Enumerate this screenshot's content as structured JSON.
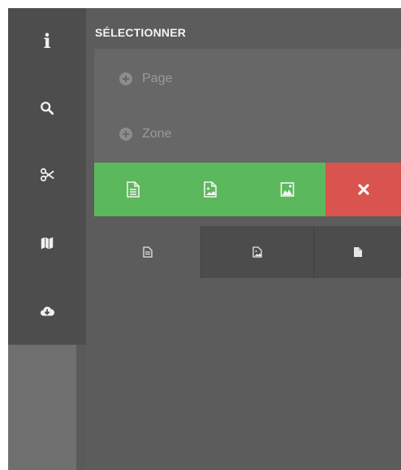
{
  "rail": {
    "items": [
      {
        "icon": "info-icon",
        "glyph": "i"
      },
      {
        "icon": "search-icon"
      },
      {
        "icon": "scissors-icon"
      },
      {
        "icon": "map-icon"
      },
      {
        "icon": "cloud-download-icon"
      }
    ]
  },
  "panel": {
    "title": "SÉLECTIONNER",
    "select_items": [
      {
        "label": "Page",
        "icon": "plus-circle-icon"
      },
      {
        "label": "Zone",
        "icon": "plus-circle-icon"
      }
    ],
    "actions": [
      {
        "icon": "file-text-icon",
        "color": "#5cb85c"
      },
      {
        "icon": "file-image-icon",
        "color": "#5cb85c"
      },
      {
        "icon": "image-icon",
        "color": "#5cb85c"
      },
      {
        "icon": "close-icon",
        "color": "#d9534f"
      }
    ],
    "tabs": [
      {
        "icon": "file-text-icon",
        "active": true
      },
      {
        "icon": "file-image-icon",
        "active": false
      },
      {
        "icon": "file-icon",
        "active": false
      }
    ]
  },
  "colors": {
    "accent_green": "#5cb85c",
    "accent_red": "#d9534f",
    "panel_bg": "#5c5c5c",
    "rail_bg": "#4d4d4d"
  }
}
